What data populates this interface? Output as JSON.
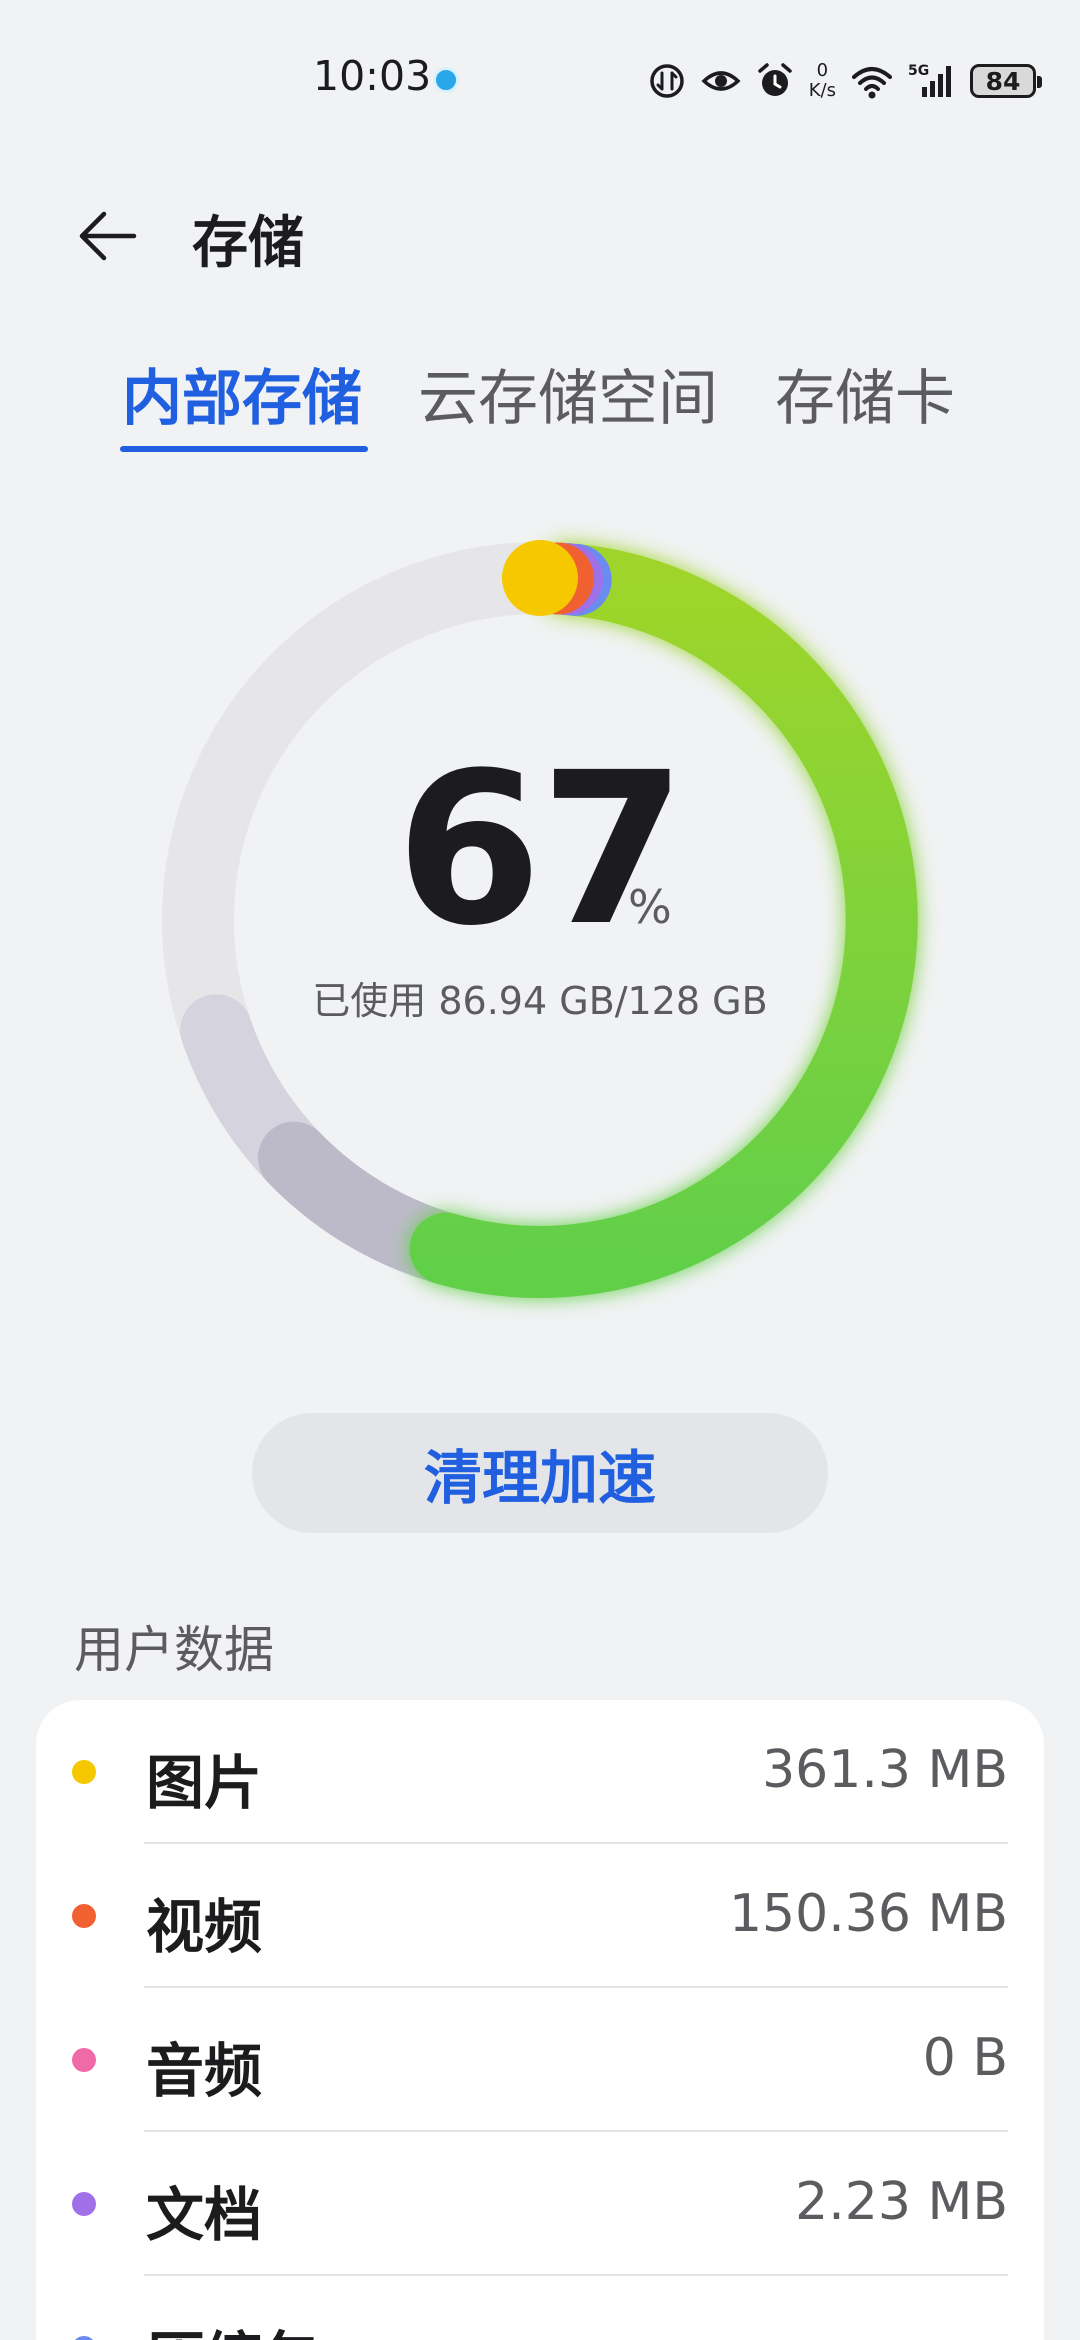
{
  "status_bar": {
    "time": "10:03",
    "net_speed_value": "0",
    "net_speed_unit": "K/s",
    "battery": "84",
    "icons": [
      "data-saver-icon",
      "eye-comfort-icon",
      "alarm-icon",
      "wifi-icon",
      "signal-5g-icon",
      "battery-icon"
    ]
  },
  "header": {
    "back_icon": "back-arrow-icon",
    "title": "存储"
  },
  "tabs": [
    {
      "label": "内部存储",
      "active": true
    },
    {
      "label": "云存储空间",
      "active": false
    },
    {
      "label": "存储卡",
      "active": false
    }
  ],
  "usage": {
    "percent": "67",
    "percent_sign": "%",
    "used_text": "已使用 86.94 GB/128 GB",
    "used_fraction": 0.67
  },
  "clean_button": {
    "label": "清理加速"
  },
  "user_data": {
    "title": "用户数据",
    "items": [
      {
        "name": "图片",
        "size": "361.3 MB",
        "color": "#f5c800"
      },
      {
        "name": "视频",
        "size": "150.36 MB",
        "color": "#f06030"
      },
      {
        "name": "音频",
        "size": "0 B",
        "color": "#f06aa8"
      },
      {
        "name": "文档",
        "size": "2.23 MB",
        "color": "#a070e8"
      },
      {
        "name": "压缩包",
        "size": "",
        "color": "#6a8cf0"
      }
    ]
  },
  "colors": {
    "accent": "#1f5fe0",
    "ring_green": "#7fd33a",
    "ring_gray": "#c9c7d4",
    "ring_track": "#e6e6e9"
  }
}
